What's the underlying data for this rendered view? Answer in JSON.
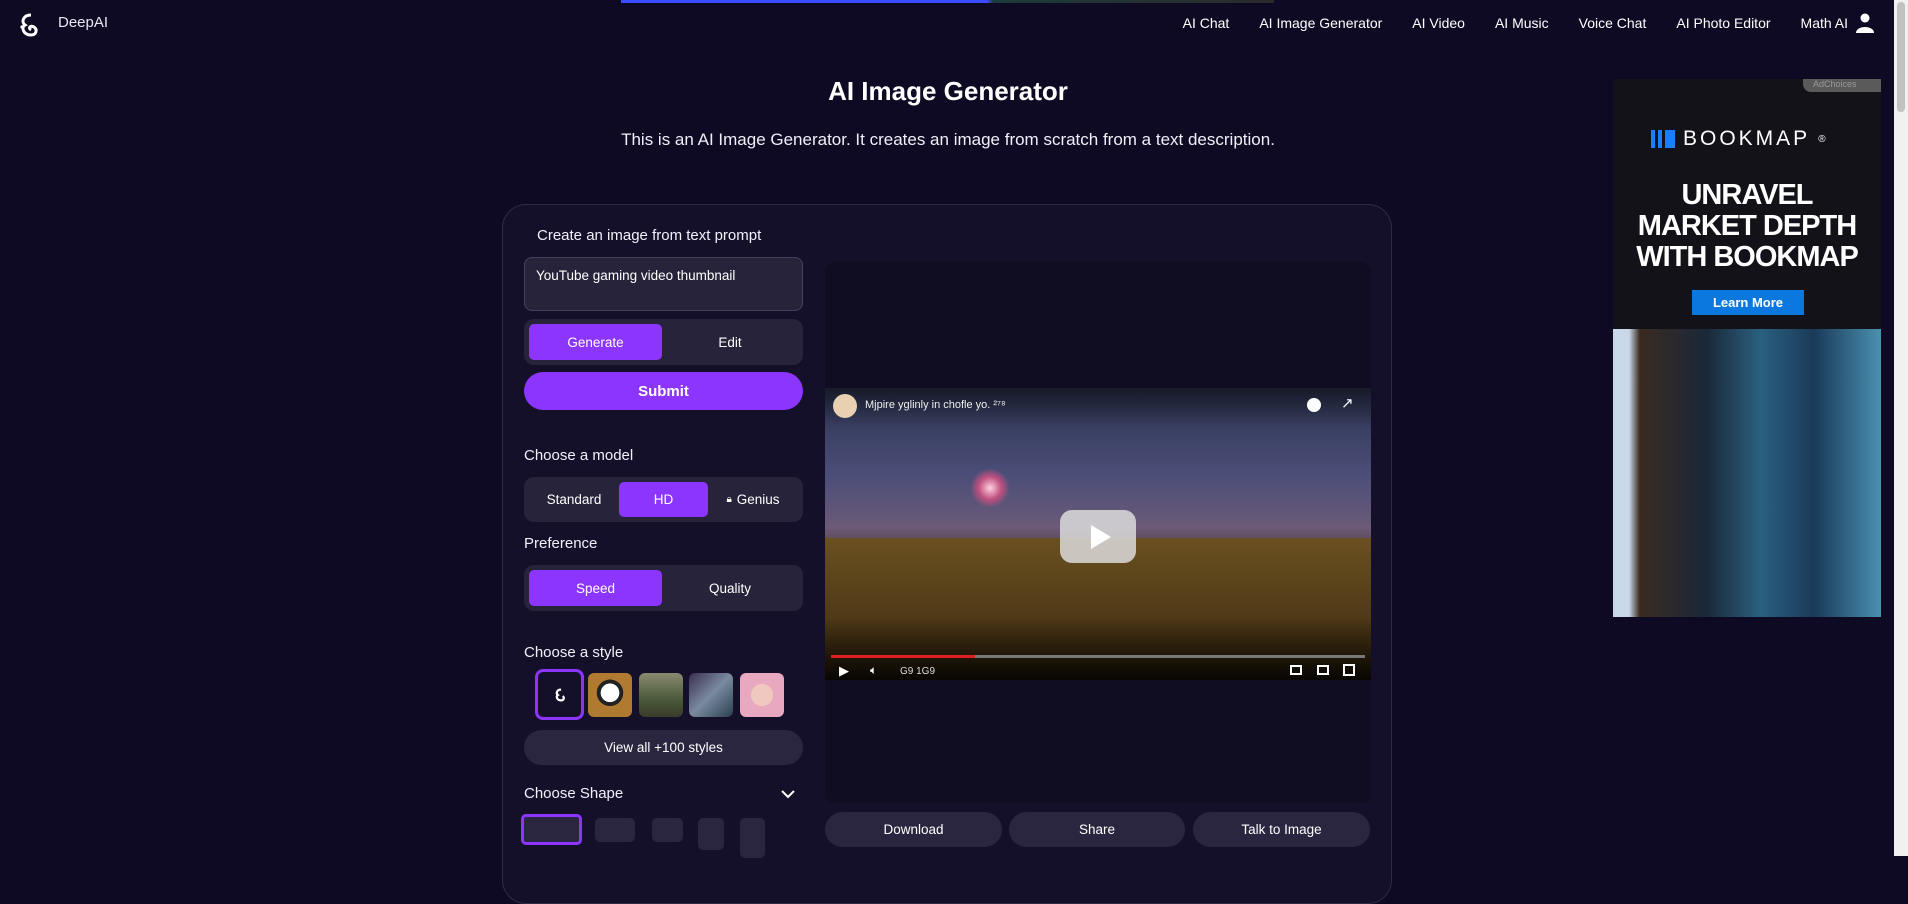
{
  "header": {
    "brand": "DeepAI",
    "nav": [
      "AI Chat",
      "AI Image Generator",
      "AI Video",
      "AI Music",
      "Voice Chat",
      "AI Photo Editor",
      "Math AI"
    ]
  },
  "page": {
    "title": "AI Image Generator",
    "subtitle": "This is an AI Image Generator. It creates an image from scratch from a text description."
  },
  "form": {
    "prompt_label": "Create an image from text prompt",
    "prompt_value": "YouTube gaming video thumbnail",
    "mode": {
      "generate": "Generate",
      "edit": "Edit"
    },
    "submit": "Submit",
    "model_label": "Choose a model",
    "models": {
      "standard": "Standard",
      "hd": "HD",
      "genius": "Genius"
    },
    "preference_label": "Preference",
    "preferences": {
      "speed": "Speed",
      "quality": "Quality"
    },
    "style_label": "Choose a style",
    "view_all": "View all +100 styles",
    "shape_label": "Choose Shape"
  },
  "result": {
    "video_title": "Mjpire yglinly in chofle yo. ²⁷⁸",
    "video_time": "G9 1G9",
    "progress": 0.27,
    "actions": {
      "download": "Download",
      "share": "Share",
      "talk": "Talk to Image"
    }
  },
  "ad": {
    "adchoices": "AdChoices",
    "brand": "BOOKMAP",
    "headline": "UNRAVEL MARKET DEPTH WITH BOOKMAP",
    "cta": "Learn More"
  },
  "colors": {
    "accent": "#8c35ff",
    "background": "#0f0a23",
    "ad_cta": "#0b78e0"
  }
}
